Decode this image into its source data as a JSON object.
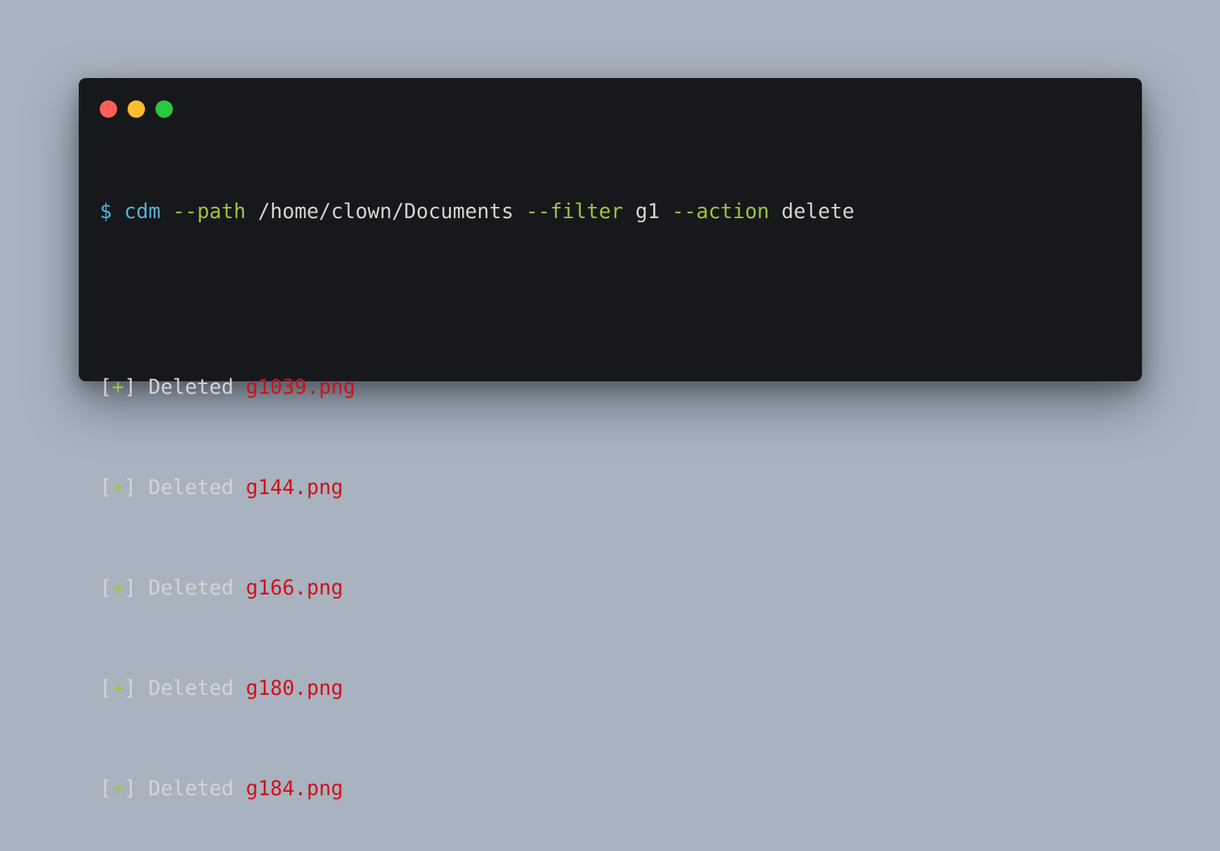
{
  "window_controls": {
    "close_color": "#ff5f57",
    "minimize_color": "#febc2e",
    "maximize_color": "#28c840"
  },
  "command": {
    "prompt": "$",
    "program": "cdm",
    "flag_path": "--path",
    "path_value": "/home/clown/Documents",
    "flag_filter": "--filter",
    "filter_value": "g1",
    "flag_action": "--action",
    "action_value": "delete"
  },
  "output": [
    {
      "open": "[",
      "mark": "+",
      "close": "]",
      "verb": "Deleted",
      "file": "g1039.png"
    },
    {
      "open": "[",
      "mark": "+",
      "close": "]",
      "verb": "Deleted",
      "file": "g144.png"
    },
    {
      "open": "[",
      "mark": "+",
      "close": "]",
      "verb": "Deleted",
      "file": "g166.png"
    },
    {
      "open": "[",
      "mark": "+",
      "close": "]",
      "verb": "Deleted",
      "file": "g180.png"
    },
    {
      "open": "[",
      "mark": "+",
      "close": "]",
      "verb": "Deleted",
      "file": "g184.png"
    }
  ],
  "colors": {
    "background": "#a8b3bf",
    "terminal": "#17181b",
    "command_blue": "#56b2d8",
    "flag_green": "#9bc53d",
    "text": "#d4d4d4",
    "file_red": "#d0101a"
  }
}
